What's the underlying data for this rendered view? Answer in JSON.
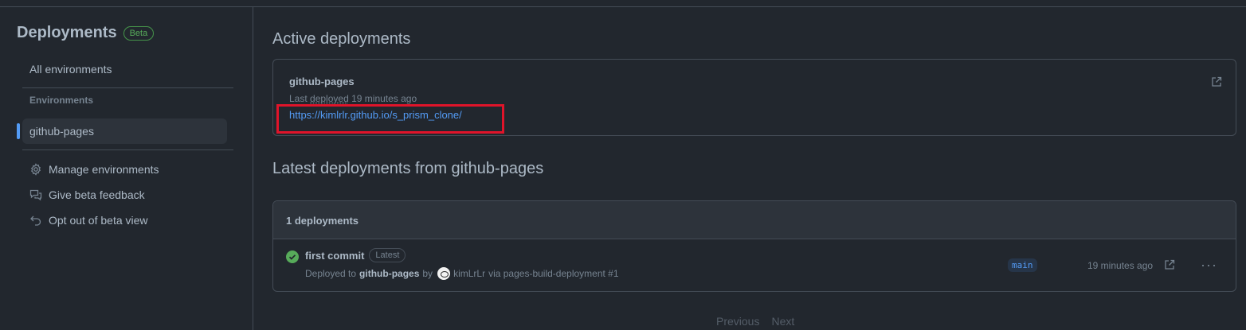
{
  "sidebar": {
    "title": "Deployments",
    "beta_badge": "Beta",
    "all_environments": "All environments",
    "environments_heading": "Environments",
    "environments": [
      {
        "label": "github-pages",
        "selected": true
      }
    ],
    "actions": [
      {
        "label": "Manage environments",
        "icon": "gear-icon"
      },
      {
        "label": "Give beta feedback",
        "icon": "comment-discussion-icon"
      },
      {
        "label": "Opt out of beta view",
        "icon": "undo-icon"
      }
    ]
  },
  "active": {
    "heading": "Active deployments",
    "environment": "github-pages",
    "last_deployed_prefix": "Last",
    "last_deployed_word": "deployed",
    "last_deployed_suffix": "19 minutes ago",
    "url": "https://kimlrlr.github.io/s_prism_clone/"
  },
  "latest": {
    "heading": "Latest deployments from github-pages",
    "count_label": "1 deployments",
    "rows": [
      {
        "commit": "first commit",
        "badge": "Latest",
        "deployed_to_prefix": "Deployed to",
        "environment": "github-pages",
        "by": "by",
        "user": "kimLrLr",
        "via": "via pages-build-deployment #1",
        "branch": "main",
        "time": "19 minutes ago",
        "status": "success"
      }
    ]
  },
  "pagination": {
    "previous": "Previous",
    "next": "Next"
  },
  "colors": {
    "background": "#22272e",
    "accent": "#539bf5",
    "success": "#57ab5a",
    "highlight": "#e0142a"
  }
}
